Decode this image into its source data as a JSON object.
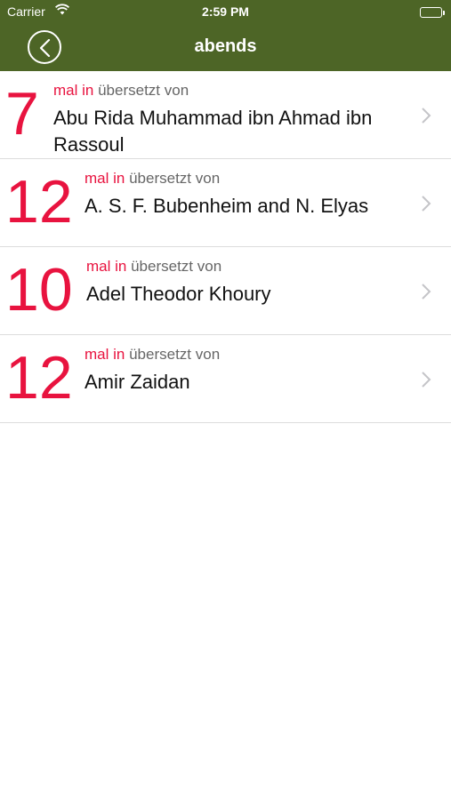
{
  "statusbar": {
    "carrier": "Carrier",
    "time": "2:59 PM"
  },
  "navbar": {
    "title": "abends",
    "back_icon": "back-chevron-circle-icon",
    "color": "#4d6526"
  },
  "accent_color": "#e8133f",
  "rows": [
    {
      "count": "7",
      "mal": "mal in",
      "sub": "übersetzt von",
      "name": "Abu Rida Muhammad ibn Ahmad ibn Rassoul"
    },
    {
      "count": "12",
      "mal": "mal in",
      "sub": "übersetzt von",
      "name": "A. S. F. Bubenheim and N. Elyas"
    },
    {
      "count": "10",
      "mal": "mal in",
      "sub": "übersetzt von",
      "name": "Adel Theodor Khoury"
    },
    {
      "count": "12",
      "mal": "mal in",
      "sub": "übersetzt von",
      "name": "Amir Zaidan"
    }
  ]
}
